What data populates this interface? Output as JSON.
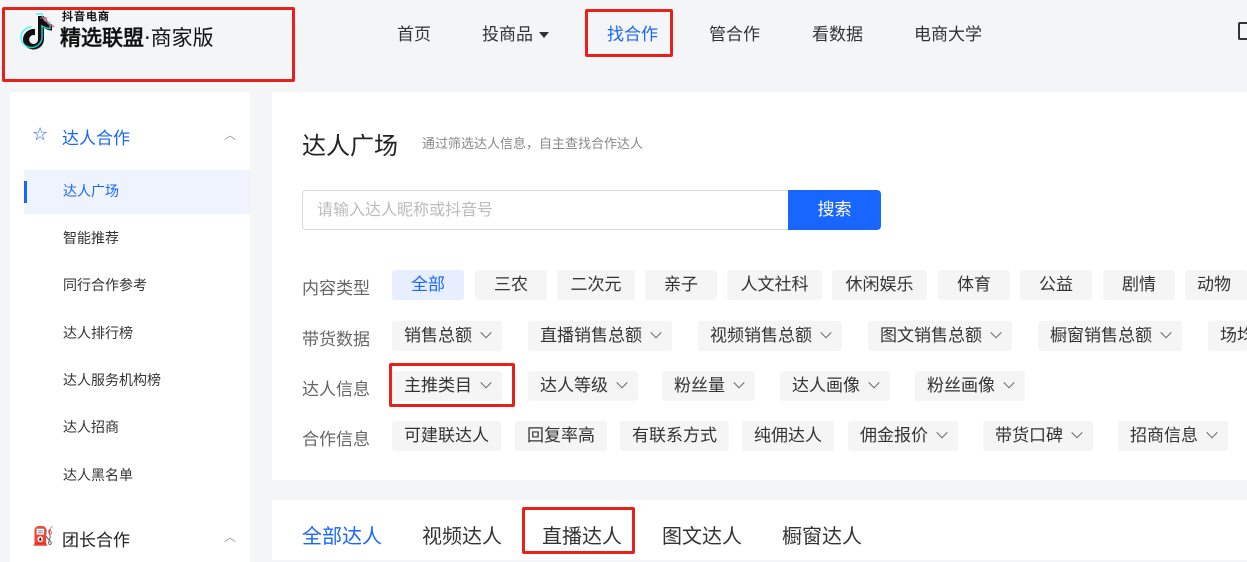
{
  "logo": {
    "small_text": "抖音电商",
    "title": "精选联盟",
    "subtitle": "·商家版"
  },
  "nav": {
    "items": [
      {
        "label": "首页"
      },
      {
        "label": "投商品"
      },
      {
        "label": "找合作"
      },
      {
        "label": "管合作"
      },
      {
        "label": "看数据"
      },
      {
        "label": "电商大学"
      }
    ],
    "active": "找合作"
  },
  "sidebar": {
    "group1": {
      "label": "达人合作",
      "icon": "star-icon"
    },
    "items": [
      {
        "label": "达人广场"
      },
      {
        "label": "智能推荐"
      },
      {
        "label": "同行合作参考"
      },
      {
        "label": "达人排行榜"
      },
      {
        "label": "达人服务机构榜"
      },
      {
        "label": "达人招商"
      },
      {
        "label": "达人黑名单"
      }
    ],
    "group2": {
      "label": "团长合作",
      "icon": "team-icon"
    }
  },
  "main": {
    "title": "达人广场",
    "description": "通过筛选达人信息，自主查找合作达人",
    "search": {
      "placeholder": "请输入达人昵称或抖音号",
      "button": "搜索"
    },
    "filters": {
      "content_type": {
        "label": "内容类型",
        "options": [
          "全部",
          "三农",
          "二次元",
          "亲子",
          "人文社科",
          "休闲娱乐",
          "体育",
          "公益",
          "剧情",
          "动物"
        ]
      },
      "sales_data": {
        "label": "带货数据",
        "options": [
          "销售总额",
          "直播销售总额",
          "视频销售总额",
          "图文销售总额",
          "橱窗销售总额",
          "场均"
        ]
      },
      "talent_info": {
        "label": "达人信息",
        "options": [
          "主推类目",
          "达人等级",
          "粉丝量",
          "达人画像",
          "粉丝画像"
        ]
      },
      "coop_info": {
        "label": "合作信息",
        "options": [
          "可建联达人",
          "回复率高",
          "有联系方式",
          "纯佣达人",
          "佣金报价",
          "带货口碑",
          "招商信息"
        ]
      }
    }
  },
  "tabs": [
    "全部达人",
    "视频达人",
    "直播达人",
    "图文达人",
    "橱窗达人"
  ],
  "colors": {
    "accent": "#1966ff",
    "highlight": "#e8201a"
  }
}
